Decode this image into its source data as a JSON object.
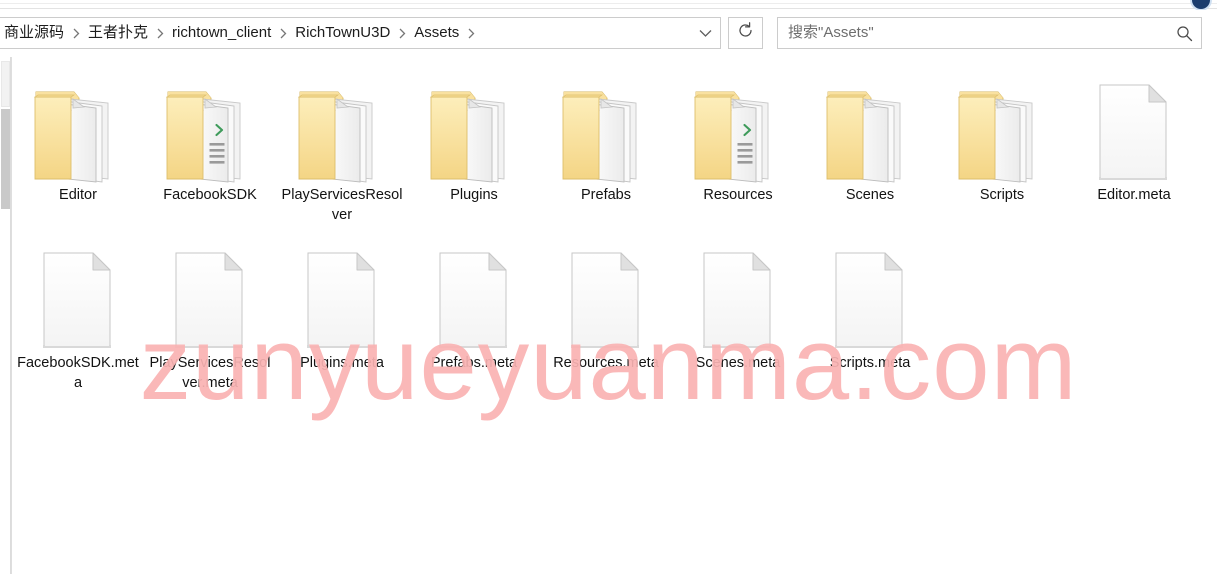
{
  "window": {
    "avatar_icon": "user-avatar-icon"
  },
  "toolbar": {
    "breadcrumb": {
      "items": [
        {
          "label": "商业源码"
        },
        {
          "label": "王者扑克"
        },
        {
          "label": "richtown_client"
        },
        {
          "label": "RichTownU3D"
        },
        {
          "label": "Assets"
        }
      ],
      "separator_icon": "chevron-right-icon",
      "dropdown_icon": "chevron-down-icon"
    },
    "refresh": {
      "label": "",
      "icon": "refresh-icon",
      "tooltip": "刷新"
    },
    "search": {
      "value": "",
      "placeholder": "搜索\"Assets\"",
      "icon": "search-icon"
    }
  },
  "content": {
    "view": "large-icons",
    "scrollbar": {
      "orientation": "vertical",
      "position": "left"
    },
    "items": [
      {
        "name": "Editor",
        "type": "folder",
        "icon": "folder-documents-icon",
        "row": 0,
        "col": 0
      },
      {
        "name": "FacebookSDK",
        "type": "folder",
        "icon": "folder-code-icon",
        "row": 0,
        "col": 1
      },
      {
        "name": "PlayServicesResolver",
        "type": "folder",
        "icon": "folder-documents-icon",
        "row": 0,
        "col": 2
      },
      {
        "name": "Plugins",
        "type": "folder",
        "icon": "folder-documents-icon",
        "row": 0,
        "col": 3
      },
      {
        "name": "Prefabs",
        "type": "folder",
        "icon": "folder-documents-icon",
        "row": 0,
        "col": 4
      },
      {
        "name": "Resources",
        "type": "folder",
        "icon": "folder-code-icon",
        "row": 0,
        "col": 5
      },
      {
        "name": "Scenes",
        "type": "folder",
        "icon": "folder-documents-icon",
        "row": 0,
        "col": 6
      },
      {
        "name": "Scripts",
        "type": "folder",
        "icon": "folder-documents-icon",
        "row": 0,
        "col": 7
      },
      {
        "name": "Editor.meta",
        "type": "file",
        "icon": "blank-document-icon",
        "row": 0,
        "col": 8
      },
      {
        "name": "FacebookSDK.meta",
        "type": "file",
        "icon": "blank-document-icon",
        "row": 1,
        "col": 0
      },
      {
        "name": "PlayServicesResolver.meta",
        "type": "file",
        "icon": "blank-document-icon",
        "row": 1,
        "col": 1
      },
      {
        "name": "Plugins.meta",
        "type": "file",
        "icon": "blank-document-icon",
        "row": 1,
        "col": 2
      },
      {
        "name": "Prefabs.meta",
        "type": "file",
        "icon": "blank-document-icon",
        "row": 1,
        "col": 3
      },
      {
        "name": "Resources.meta",
        "type": "file",
        "icon": "blank-document-icon",
        "row": 1,
        "col": 4
      },
      {
        "name": "Scenes.meta",
        "type": "file",
        "icon": "blank-document-icon",
        "row": 1,
        "col": 5
      },
      {
        "name": "Scripts.meta",
        "type": "file",
        "icon": "blank-document-icon",
        "row": 1,
        "col": 6
      }
    ]
  },
  "watermark": {
    "text": "zunyueyuanma.com",
    "color": "#fab3b3"
  }
}
